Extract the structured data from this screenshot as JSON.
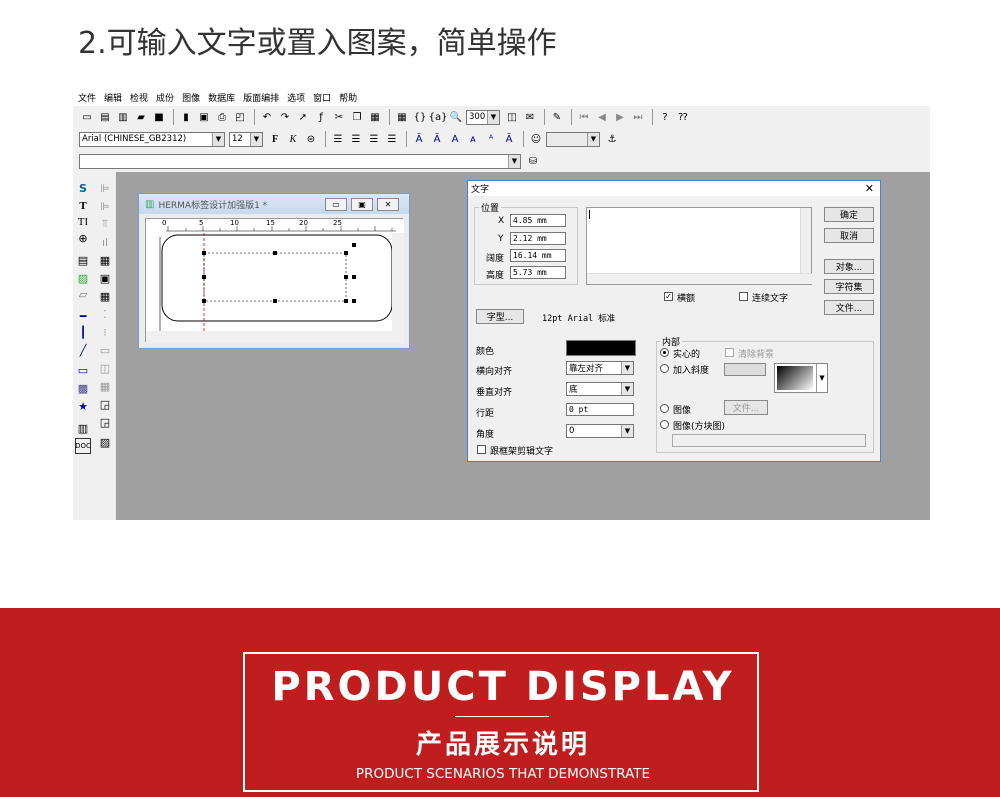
{
  "heading": "2.可输入文字或置入图案，简单操作",
  "menu": [
    "文件",
    "编辑",
    "检视",
    "成份",
    "图像",
    "数据库",
    "版面编排",
    "选项",
    "窗口",
    "帮助"
  ],
  "toolbar": {
    "zoom": "300",
    "font": "Arial (CHINESE_GB2312)",
    "size": "12"
  },
  "docwin": {
    "title": "HERMA标签设计加强版1 *",
    "ruler": [
      "0",
      "5",
      "10",
      "15",
      "20",
      "25"
    ]
  },
  "dialog": {
    "title": "文字",
    "position_group": "位置",
    "x_label": "X",
    "x_value": "4.85 mm",
    "y_label": "Y",
    "y_value": "2.12 mm",
    "width_label": "阔度",
    "width_value": "16.14 mm",
    "height_label": "高度",
    "height_value": "5.73 mm",
    "ok": "确定",
    "cancel": "取消",
    "object": "对象...",
    "charset": "字符集",
    "file": "文件...",
    "horizontal": "横额",
    "continuous": "连续文字",
    "font_button": "字型...",
    "font_desc": "12pt Arial 标准",
    "color_label": "颜色",
    "halign_label": "横向对齐",
    "halign_value": "靠左对齐",
    "valign_label": "垂直对齐",
    "valign_value": "底",
    "linespacing_label": "行距",
    "linespacing_value": "0 pt",
    "angle_label": "角度",
    "angle_value": "0",
    "clip_label": "跟框架剪辑文字",
    "inner_group": "内部",
    "solid": "实心的",
    "clear_bg": "清除背景",
    "gradient": "加入斜度",
    "image": "图像",
    "image_file": "文件...",
    "image_block": "图像(方块图)",
    "colors": {
      "text": "#000000"
    }
  },
  "banner": {
    "title": "PRODUCT DISPLAY",
    "cn": "产品展示说明",
    "en": "PRODUCT SCENARIOS THAT DEMONSTRATE"
  }
}
